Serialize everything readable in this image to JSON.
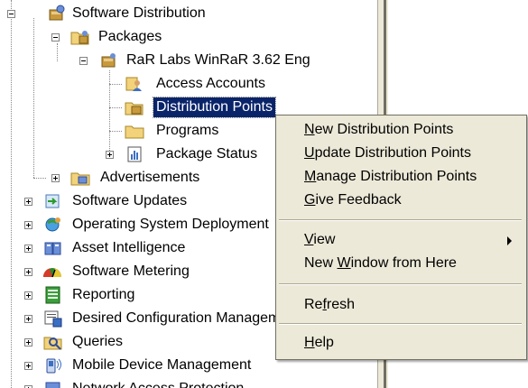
{
  "tree": {
    "software_distribution": "Software Distribution",
    "packages": "Packages",
    "package_name": "RaR Labs WinRaR 3.62 Eng",
    "access_accounts": "Access Accounts",
    "distribution_points": "Distribution Points",
    "programs": "Programs",
    "package_status": "Package Status",
    "advertisements": "Advertisements",
    "software_updates": "Software Updates",
    "os_deployment": "Operating System Deployment",
    "asset_intelligence": "Asset Intelligence",
    "software_metering": "Software Metering",
    "reporting": "Reporting",
    "desired_config": "Desired Configuration Management",
    "queries": "Queries",
    "mobile_device": "Mobile Device Management",
    "network_access": "Network Access Protection"
  },
  "context_menu": {
    "new_dp": {
      "mnemonic": "N",
      "rest": "ew Distribution Points"
    },
    "update_dp": {
      "mnemonic": "U",
      "rest": "pdate Distribution Points"
    },
    "manage_dp": {
      "mnemonic": "M",
      "rest": "anage Distribution Points"
    },
    "give_feedback": {
      "mnemonic": "G",
      "rest": "ive Feedback"
    },
    "view": {
      "mnemonic": "V",
      "rest": "iew"
    },
    "new_window": {
      "pre": "New ",
      "mnemonic": "W",
      "rest": "indow from Here"
    },
    "refresh": {
      "pre": "Re",
      "mnemonic": "f",
      "rest": "resh"
    },
    "help": {
      "mnemonic": "H",
      "rest": "elp"
    }
  },
  "colors": {
    "selection": "#0a246a",
    "menu_background": "#ece9d8"
  }
}
